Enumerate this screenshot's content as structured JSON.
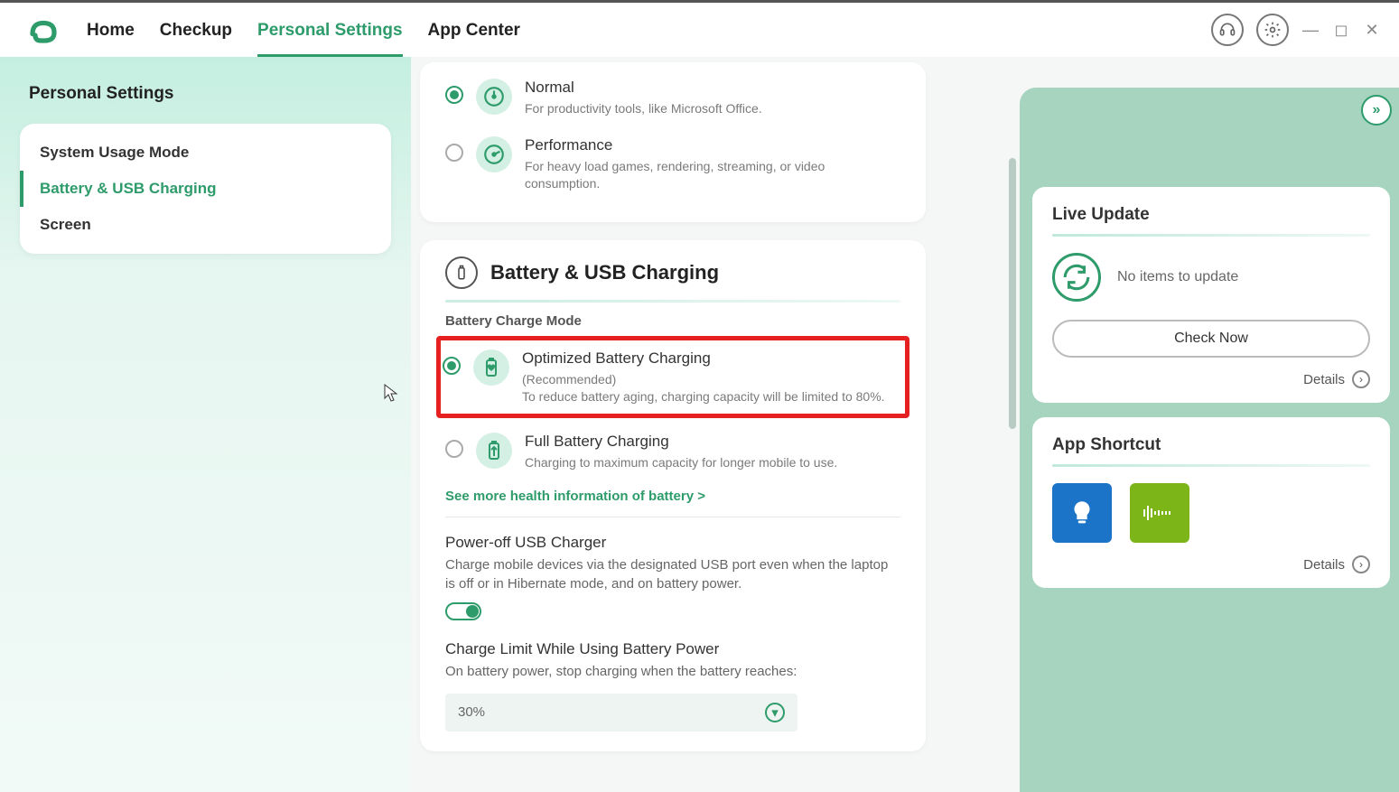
{
  "nav": {
    "home": "Home",
    "checkup": "Checkup",
    "personal_settings": "Personal Settings",
    "app_center": "App Center"
  },
  "sidebar": {
    "title": "Personal Settings",
    "items": [
      {
        "label": "System Usage Mode"
      },
      {
        "label": "Battery & USB Charging"
      },
      {
        "label": "Screen"
      }
    ]
  },
  "usage_mode": {
    "normal": {
      "title": "Normal",
      "desc": "For productivity tools, like Microsoft Office."
    },
    "performance": {
      "title": "Performance",
      "desc": "For heavy load games, rendering, streaming, or video consumption."
    }
  },
  "battery": {
    "section_title": "Battery & USB Charging",
    "mode_label": "Battery Charge Mode",
    "optimized": {
      "title": "Optimized Battery Charging",
      "rec": "(Recommended)",
      "desc": "To reduce battery aging, charging capacity will be limited to 80%."
    },
    "full": {
      "title": "Full Battery Charging",
      "desc": "Charging to maximum capacity for longer mobile to use."
    },
    "more_info": "See more health information of battery  >",
    "usb": {
      "title": "Power-off USB Charger",
      "desc": "Charge mobile devices via the designated USB port even when the laptop is off or in Hibernate mode, and on battery power."
    },
    "limit": {
      "title": "Charge Limit While Using Battery Power",
      "desc": "On battery power, stop charging when the battery reaches:",
      "value": "30%"
    }
  },
  "live_update": {
    "title": "Live Update",
    "status": "No items to update",
    "button": "Check Now",
    "details": "Details"
  },
  "app_shortcut": {
    "title": "App Shortcut",
    "details": "Details"
  }
}
